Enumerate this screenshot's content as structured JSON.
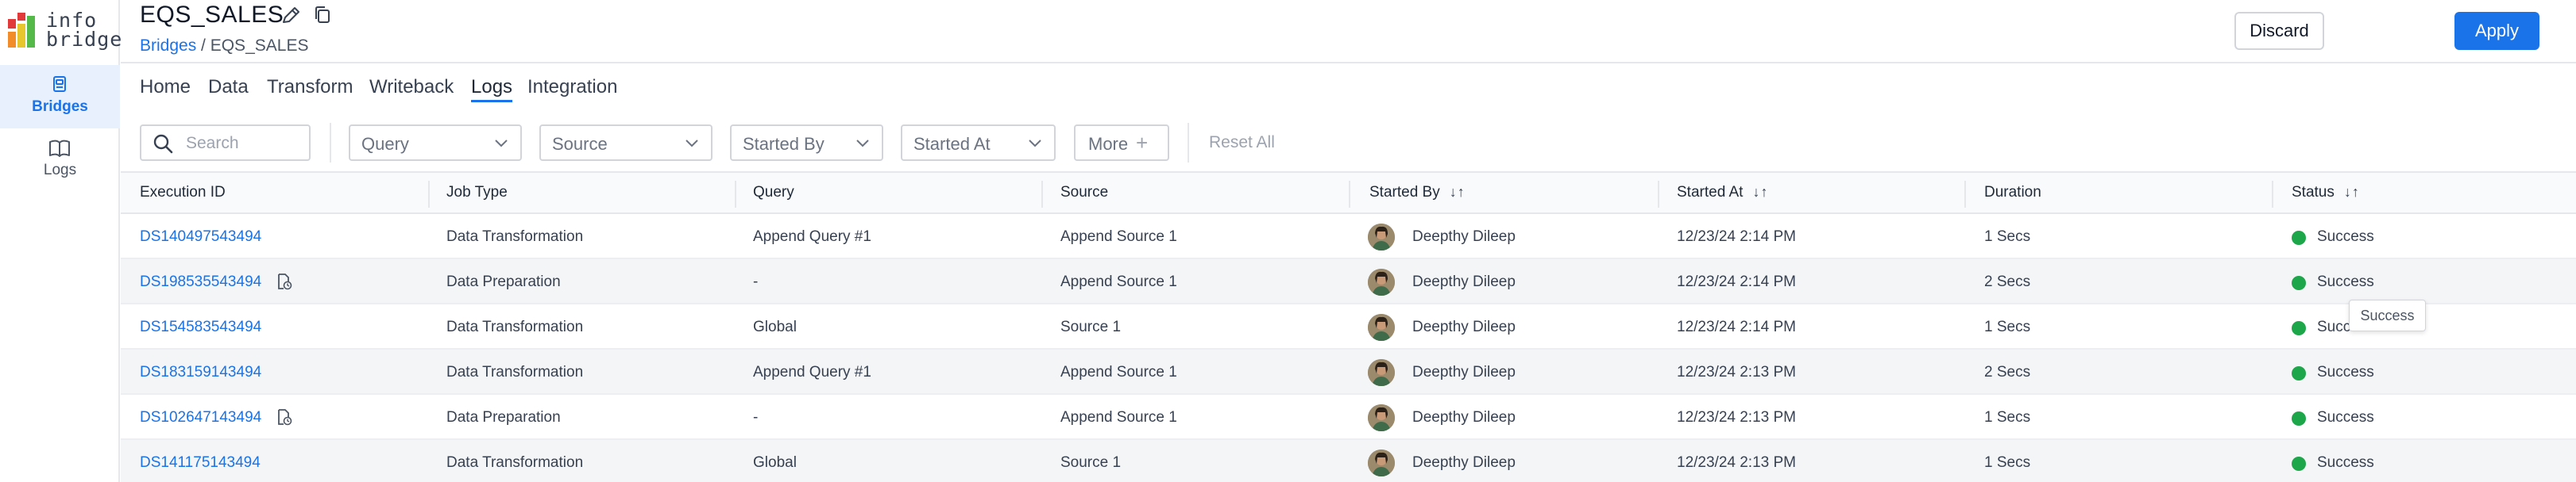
{
  "logo": {
    "line1": "info",
    "line2": "bridge"
  },
  "sidebar": {
    "items": [
      {
        "label": "Bridges",
        "icon": "bridges-icon",
        "active": true
      },
      {
        "label": "Logs",
        "icon": "book-icon",
        "active": false
      }
    ]
  },
  "header": {
    "title": "EQS_SALES",
    "breadcrumb": {
      "root": "Bridges",
      "separator": " / ",
      "current": "EQS_SALES"
    },
    "discard_label": "Discard",
    "apply_label": "Apply"
  },
  "tabs": [
    {
      "label": "Home",
      "active": false
    },
    {
      "label": "Data",
      "active": false
    },
    {
      "label": "Transform",
      "active": false
    },
    {
      "label": "Writeback",
      "active": false
    },
    {
      "label": "Logs",
      "active": true
    },
    {
      "label": "Integration",
      "active": false
    }
  ],
  "filters": {
    "search_placeholder": "Search",
    "dropdowns": [
      "Query",
      "Source",
      "Started By",
      "Started At"
    ],
    "more_label": "More",
    "reset_label": "Reset All"
  },
  "table": {
    "columns": [
      {
        "label": "Execution ID",
        "sortable": false
      },
      {
        "label": "Job Type",
        "sortable": false
      },
      {
        "label": "Query",
        "sortable": false
      },
      {
        "label": "Source",
        "sortable": false
      },
      {
        "label": "Started By",
        "sortable": true
      },
      {
        "label": "Started At",
        "sortable": true
      },
      {
        "label": "Duration",
        "sortable": false
      },
      {
        "label": "Status",
        "sortable": true
      }
    ],
    "sort_glyph": "↓↑",
    "rows": [
      {
        "id": "DS140497543494",
        "doc_icon": false,
        "job_type": "Data Transformation",
        "query": "Append Query #1",
        "source": "Append Source 1",
        "started_by": "Deepthy Dileep",
        "started_at": "12/23/24 2:14 PM",
        "duration": "1 Secs",
        "status": "Success"
      },
      {
        "id": "DS198535543494",
        "doc_icon": true,
        "job_type": "Data Preparation",
        "query": "-",
        "source": "Append Source 1",
        "started_by": "Deepthy Dileep",
        "started_at": "12/23/24 2:14 PM",
        "duration": "2 Secs",
        "status": "Success"
      },
      {
        "id": "DS154583543494",
        "doc_icon": false,
        "job_type": "Data Transformation",
        "query": "Global",
        "source": "Source 1",
        "started_by": "Deepthy Dileep",
        "started_at": "12/23/24 2:14 PM",
        "duration": "1 Secs",
        "status": "Success"
      },
      {
        "id": "DS183159143494",
        "doc_icon": false,
        "job_type": "Data Transformation",
        "query": "Append Query #1",
        "source": "Append Source 1",
        "started_by": "Deepthy Dileep",
        "started_at": "12/23/24 2:13 PM",
        "duration": "2 Secs",
        "status": "Success"
      },
      {
        "id": "DS102647143494",
        "doc_icon": true,
        "job_type": "Data Preparation",
        "query": "-",
        "source": "Append Source 1",
        "started_by": "Deepthy Dileep",
        "started_at": "12/23/24 2:13 PM",
        "duration": "1 Secs",
        "status": "Success"
      },
      {
        "id": "DS141175143494",
        "doc_icon": false,
        "job_type": "Data Transformation",
        "query": "Global",
        "source": "Source 1",
        "started_by": "Deepthy Dileep",
        "started_at": "12/23/24 2:13 PM",
        "duration": "1 Secs",
        "status": "Success"
      }
    ]
  },
  "tooltip": {
    "text": "Success"
  },
  "colors": {
    "accent": "#1a73e8",
    "success": "#1ea64a",
    "row_alt": "#f4f5f7",
    "sidebar_active": "#e8f0fe"
  }
}
